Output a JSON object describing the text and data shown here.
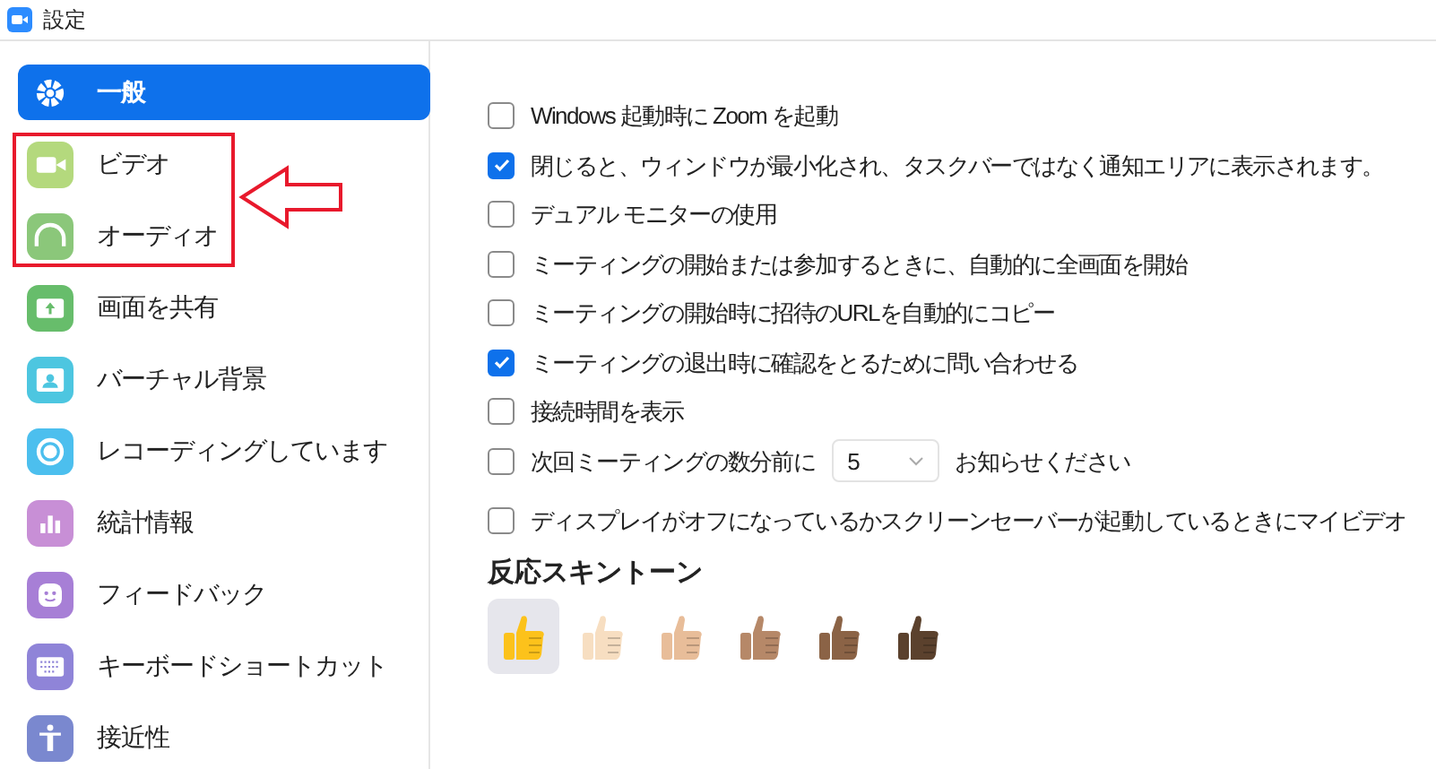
{
  "window": {
    "title": "設定"
  },
  "sidebar": {
    "items": [
      {
        "label": "一般",
        "kind": "gear",
        "selected": true
      },
      {
        "label": "ビデオ",
        "kind": "video",
        "selected": false
      },
      {
        "label": "オーディオ",
        "kind": "headphones",
        "selected": false
      },
      {
        "label": "画面を共有",
        "kind": "share",
        "selected": false
      },
      {
        "label": "バーチャル背景",
        "kind": "background",
        "selected": false
      },
      {
        "label": "レコーディングしています",
        "kind": "record",
        "selected": false
      },
      {
        "label": "統計情報",
        "kind": "stats",
        "selected": false
      },
      {
        "label": "フィードバック",
        "kind": "feedback",
        "selected": false
      },
      {
        "label": "キーボードショートカット",
        "kind": "keyboard",
        "selected": false
      },
      {
        "label": "接近性",
        "kind": "accessibility",
        "selected": false
      }
    ]
  },
  "settings": [
    {
      "kind": "checkbox",
      "label": "Windows 起動時に Zoom を起動",
      "checked": false
    },
    {
      "kind": "checkbox",
      "label": "閉じると、ウィンドウが最小化され、タスクバーではなく通知エリアに表示されます。",
      "checked": true
    },
    {
      "kind": "checkbox",
      "label": "デュアル モニターの使用",
      "checked": false
    },
    {
      "kind": "checkbox",
      "label": "ミーティングの開始または参加するときに、自動的に全画面を開始",
      "checked": false
    },
    {
      "kind": "checkbox",
      "label": "ミーティングの開始時に招待のURLを自動的にコピー",
      "checked": false
    },
    {
      "kind": "checkbox",
      "label": "ミーティングの退出時に確認をとるために問い合わせる",
      "checked": true
    },
    {
      "kind": "checkbox",
      "label": "接続時間を表示",
      "checked": false
    },
    {
      "kind": "checkbox_select",
      "label": "次回ミーティングの数分前に",
      "value": "5",
      "suffix": "お知らせください",
      "checked": false
    },
    {
      "kind": "checkbox",
      "label": "ディスプレイがオフになっているかスクリーンセーバーが起動しているときにマイビデオ",
      "checked": false
    }
  ],
  "skin_tone": {
    "heading": "反応スキントーン",
    "options": [
      {
        "color": "#fcc21b",
        "selected": true
      },
      {
        "color": "#f7dec1",
        "selected": false
      },
      {
        "color": "#e8bd99",
        "selected": false
      },
      {
        "color": "#b68868",
        "selected": false
      },
      {
        "color": "#8b6346",
        "selected": false
      },
      {
        "color": "#5b412d",
        "selected": false
      }
    ]
  }
}
